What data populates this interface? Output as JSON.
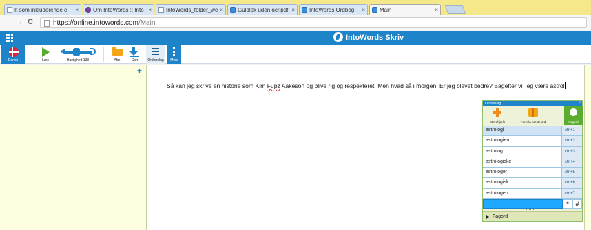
{
  "browser": {
    "tabs": [
      {
        "title": "It som inkluderende e",
        "favicon": "doc-icon"
      },
      {
        "title": "Om IntoWords :: Into",
        "favicon": "purple-icon"
      },
      {
        "title": "IntoWords_folder_we",
        "favicon": "doc-icon"
      },
      {
        "title": "Guldlok uden ocr.pdf",
        "favicon": "blue-icon"
      },
      {
        "title": "IntoWords Ordbog",
        "favicon": "blue-icon"
      },
      {
        "title": "Main",
        "favicon": "blue-icon"
      }
    ],
    "close_glyph": "×",
    "url_host": "https://online.intowords.com",
    "url_path": "/Main"
  },
  "app": {
    "brand": "IntoWords Skriv",
    "toolbar": {
      "dansk": "Dansk",
      "laes": "Læs",
      "speed": "Hastighed 133",
      "aabn": "Åbn",
      "gem": "Gem",
      "ordforslag": "Ordforslag",
      "mere": "Mere"
    }
  },
  "document": {
    "text_before": "Så kan jeg skrive en historie som Kim ",
    "text_error": "Fupz",
    "text_after": " Aakeson og blive rig og respekteret. Men hvad så i morgen. Er jeg blevet bedre? Bagefter vil jeg være astrol"
  },
  "ordforslag": {
    "title": "Ordforslag",
    "close": "×",
    "tools": {
      "stavehjaelp": "Stavehjælp",
      "foreslaa": "Foreslå næste ord",
      "fagord": "Fagord"
    },
    "suggestions": [
      {
        "word": "astrologi",
        "key": "ctrl+1"
      },
      {
        "word": "astrologien",
        "key": "ctrl+2"
      },
      {
        "word": "astrolog",
        "key": "ctrl+3"
      },
      {
        "word": "astrologiske",
        "key": "ctrl+4"
      },
      {
        "word": "astrologer",
        "key": "ctrl+5"
      },
      {
        "word": "astrologisk",
        "key": "ctrl+6"
      },
      {
        "word": "astrologen",
        "key": "ctrl+7"
      }
    ],
    "sym1": "*",
    "sym2": "#",
    "footer": "Fagord"
  },
  "colors": {
    "brand_blue": "#1e84c9",
    "panel_green": "#5aac2e",
    "side_yellow": "#fdfde0"
  }
}
